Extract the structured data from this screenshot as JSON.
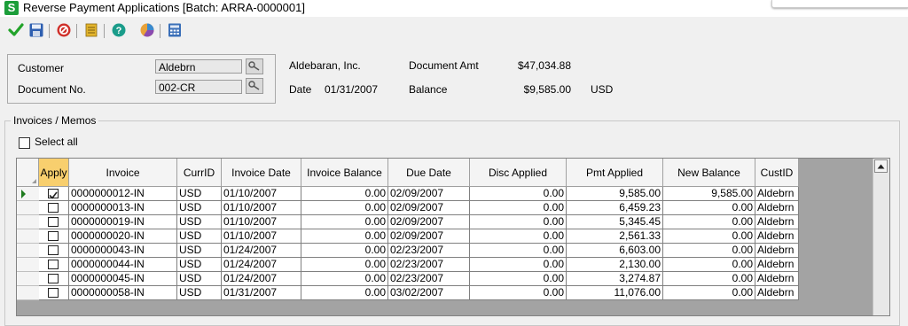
{
  "window": {
    "title": "Reverse Payment Applications [Batch: ARRA-0000001]",
    "app_icon_letter": "S"
  },
  "toolbar": {
    "buttons": [
      {
        "name": "ok-icon",
        "color": "#22a32a"
      },
      {
        "name": "save-icon",
        "color": "#2e5fb0"
      },
      {
        "name": "cancel-icon",
        "color": "#d0302a"
      },
      {
        "name": "notes-icon",
        "color": "#e3b52d"
      },
      {
        "name": "help-icon",
        "color": "#1a9c8a"
      },
      {
        "name": "chart-icon",
        "color": "#e8a23a"
      },
      {
        "name": "calculator-icon",
        "color": "#3a6fb8"
      }
    ]
  },
  "header": {
    "customer_label": "Customer",
    "customer_value": "Aldebrn",
    "docno_label": "Document No.",
    "docno_value": "002-CR",
    "customer_name": "Aldebaran, Inc.",
    "date_label": "Date",
    "date_value": "01/31/2007",
    "docamt_label": "Document Amt",
    "docamt_value": "$47,034.88",
    "balance_label": "Balance",
    "balance_value": "$9,585.00",
    "currency": "USD"
  },
  "invoices": {
    "group_title": "Invoices / Memos",
    "select_all_label": "Select all",
    "columns": [
      "Apply",
      "Invoice",
      "CurrID",
      "Invoice Date",
      "Invoice Balance",
      "Due Date",
      "Disc Applied",
      "Pmt Applied",
      "New Balance",
      "CustID"
    ],
    "rows": [
      {
        "apply": true,
        "invoice": "0000000012-IN",
        "curr": "USD",
        "inv_date": "01/10/2007",
        "inv_bal": "0.00",
        "due": "02/09/2007",
        "disc": "0.00",
        "pmt": "9,585.00",
        "new_bal": "9,585.00",
        "cust": "Aldebrn"
      },
      {
        "apply": false,
        "invoice": "0000000013-IN",
        "curr": "USD",
        "inv_date": "01/10/2007",
        "inv_bal": "0.00",
        "due": "02/09/2007",
        "disc": "0.00",
        "pmt": "6,459.23",
        "new_bal": "0.00",
        "cust": "Aldebrn"
      },
      {
        "apply": false,
        "invoice": "0000000019-IN",
        "curr": "USD",
        "inv_date": "01/10/2007",
        "inv_bal": "0.00",
        "due": "02/09/2007",
        "disc": "0.00",
        "pmt": "5,345.45",
        "new_bal": "0.00",
        "cust": "Aldebrn"
      },
      {
        "apply": false,
        "invoice": "0000000020-IN",
        "curr": "USD",
        "inv_date": "01/10/2007",
        "inv_bal": "0.00",
        "due": "02/09/2007",
        "disc": "0.00",
        "pmt": "2,561.33",
        "new_bal": "0.00",
        "cust": "Aldebrn"
      },
      {
        "apply": false,
        "invoice": "0000000043-IN",
        "curr": "USD",
        "inv_date": "01/24/2007",
        "inv_bal": "0.00",
        "due": "02/23/2007",
        "disc": "0.00",
        "pmt": "6,603.00",
        "new_bal": "0.00",
        "cust": "Aldebrn"
      },
      {
        "apply": false,
        "invoice": "0000000044-IN",
        "curr": "USD",
        "inv_date": "01/24/2007",
        "inv_bal": "0.00",
        "due": "02/23/2007",
        "disc": "0.00",
        "pmt": "2,130.00",
        "new_bal": "0.00",
        "cust": "Aldebrn"
      },
      {
        "apply": false,
        "invoice": "0000000045-IN",
        "curr": "USD",
        "inv_date": "01/24/2007",
        "inv_bal": "0.00",
        "due": "02/23/2007",
        "disc": "0.00",
        "pmt": "3,274.87",
        "new_bal": "0.00",
        "cust": "Aldebrn"
      },
      {
        "apply": false,
        "invoice": "0000000058-IN",
        "curr": "USD",
        "inv_date": "01/31/2007",
        "inv_bal": "0.00",
        "due": "03/02/2007",
        "disc": "0.00",
        "pmt": "11,076.00",
        "new_bal": "0.00",
        "cust": "Aldebrn"
      }
    ],
    "current_row": 0
  }
}
